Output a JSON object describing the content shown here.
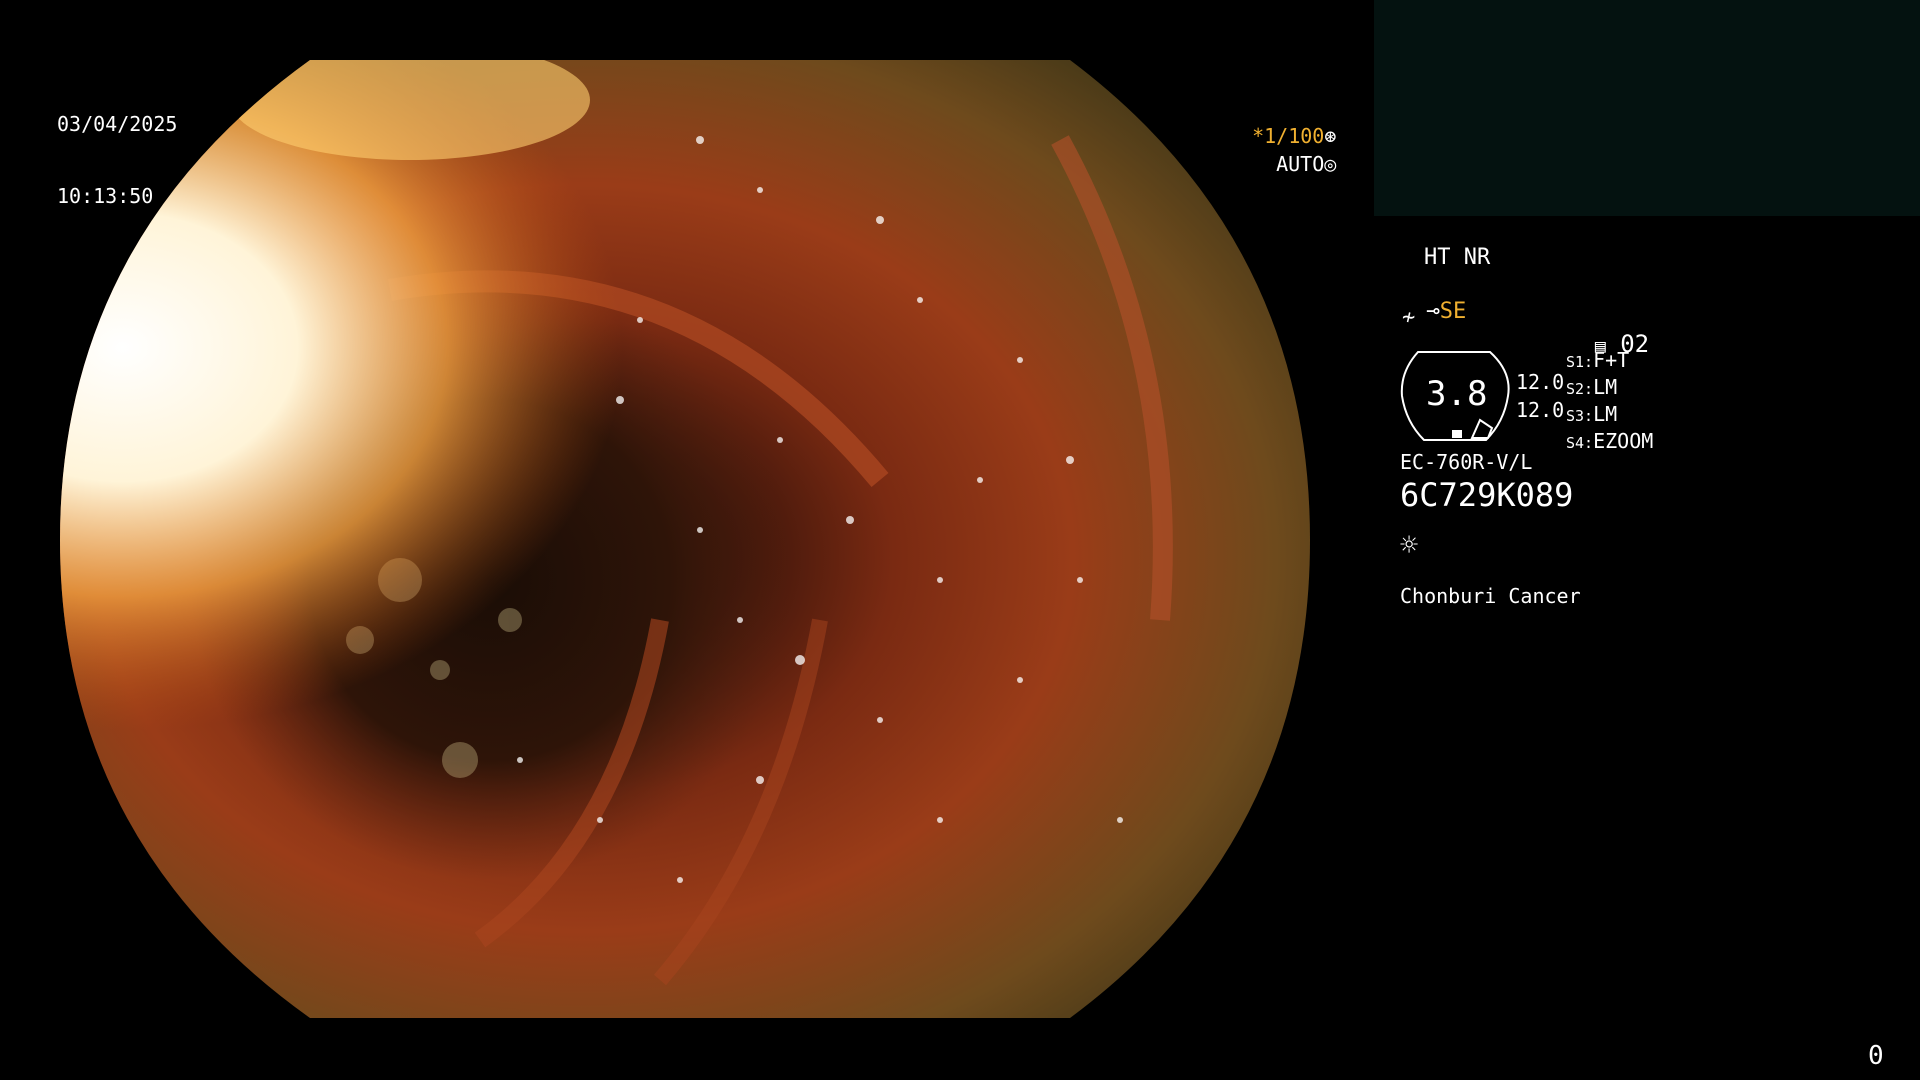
{
  "datetime": {
    "date": "03/04/2025",
    "time": "10:13:50"
  },
  "exposure": {
    "shutter": "*1/100",
    "shutter_icon": "aperture-icon",
    "mode": "AUTO",
    "mode_icon": "iris-icon"
  },
  "processor": {
    "ht_nr": "HT NR",
    "se": "SE",
    "se_icon": "scope-tip-icon",
    "freeze_icon": "freeze-icon",
    "channel": "02",
    "channel_icon": "memory-icon",
    "zoom": "3.8",
    "zoom_values": [
      "12.0",
      "12.0"
    ],
    "switches": [
      {
        "key": "S1:",
        "value": "F+T"
      },
      {
        "key": "S2:",
        "value": "LM"
      },
      {
        "key": "S3:",
        "value": "LM"
      },
      {
        "key": "S4:",
        "value": "EZOOM"
      }
    ],
    "scope_model": "EC-760R-V/L",
    "scope_serial": "6C729K089",
    "light_icon": "sun-icon",
    "hospital": "Chonburi Cancer"
  },
  "frame_counter": "0",
  "colors": {
    "amber": "#f0b030",
    "panel": "#041210"
  }
}
